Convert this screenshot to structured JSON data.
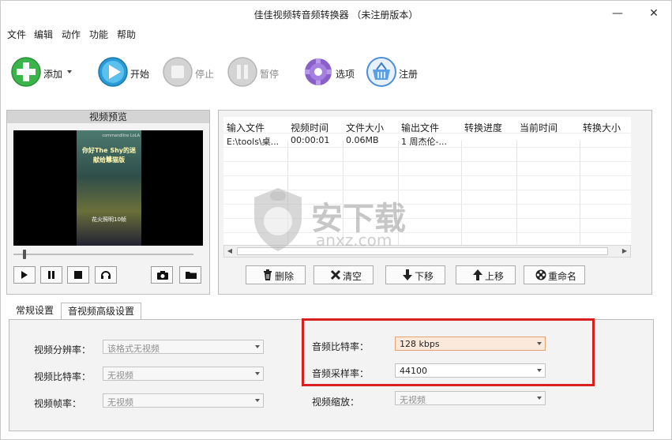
{
  "window": {
    "title": "佳佳视频转音频转换器 （未注册版本）",
    "minimize_glyph": "—",
    "close_glyph": "✕"
  },
  "menu": [
    "文件",
    "编辑",
    "动作",
    "功能",
    "帮助"
  ],
  "toolbar": {
    "add": {
      "label": "添加",
      "icon": "plus-icon",
      "color": "#3ab54a"
    },
    "start": {
      "label": "开始",
      "icon": "play-icon",
      "color": "#2a9bd6"
    },
    "stop": {
      "label": "停止",
      "icon": "stop-icon",
      "color": "#c4c4c4"
    },
    "pause": {
      "label": "暂停",
      "icon": "pause-icon",
      "color": "#c4c4c4"
    },
    "options": {
      "label": "选项",
      "icon": "gear-icon",
      "color": "#8a5fc9"
    },
    "register": {
      "label": "注册",
      "icon": "basket-icon",
      "color": "#4a8fd8"
    }
  },
  "preview": {
    "title": "视频预览",
    "video_text": [
      "你好The Shy的迷妹",
      "献给恩猫版",
      "花火照明10帧"
    ],
    "video_corner_text": "commandline LoLA"
  },
  "file_table": {
    "columns": [
      "输入文件",
      "视频时间",
      "文件大小",
      "输出文件",
      "转换进度",
      "当前时间",
      "转换大小"
    ],
    "rows": [
      {
        "input": "E:\\tools\\桌...",
        "duration": "00:00:01",
        "size": "0.06MB",
        "output": "1 周杰伦-...",
        "progress": "",
        "current": "",
        "converted": ""
      }
    ]
  },
  "list_buttons": {
    "delete": "删除",
    "clear": "清空",
    "down": "下移",
    "up": "上移",
    "rename": "重命名"
  },
  "watermark": {
    "text": "安下载",
    "sub": "anxz.com"
  },
  "tabs": [
    "常规设置",
    "音视频高级设置"
  ],
  "settings": {
    "video_resolution": {
      "label": "视频分辨率：",
      "value": "该格式无视频"
    },
    "video_bitrate": {
      "label": "视频比特率：",
      "value": "无视频"
    },
    "video_fps": {
      "label": "视频帧率：",
      "value": "无视频"
    },
    "audio_bitrate": {
      "label": "音频比特率：",
      "value": "128 kbps"
    },
    "audio_samplerate": {
      "label": "音频采样率：",
      "value": "44100"
    },
    "video_scale": {
      "label": "视频缩放：",
      "value": "无视频"
    }
  },
  "accent": {
    "highlight_border": "#d9201f"
  }
}
